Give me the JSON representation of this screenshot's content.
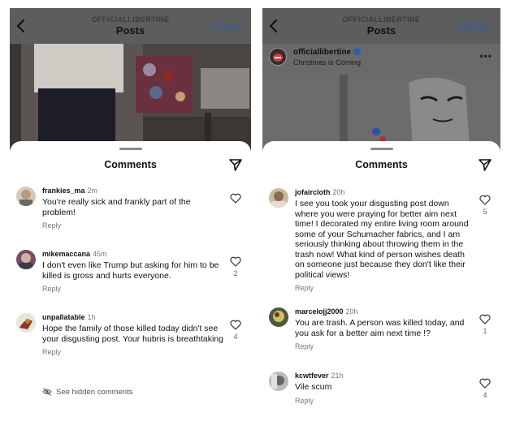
{
  "left": {
    "header": {
      "account": "OFFICIALLIBERTINE",
      "title": "Posts",
      "follow_label": "Follow"
    },
    "sheet_title": "Comments",
    "comments": [
      {
        "user": "frankies_ma",
        "time": "2m",
        "text": "You're really sick and frankly part of the problem!",
        "reply": "Reply",
        "likes": ""
      },
      {
        "user": "mikemaccana",
        "time": "45m",
        "text": "I don't even like Trump but asking for him to be killed is gross and hurts everyone.",
        "reply": "Reply",
        "likes": "2"
      },
      {
        "user": "unpallatable",
        "time": "1h",
        "text": "Hope the family of those killed today didn't see your disgusting post. Your hubris is breathtaking",
        "reply": "Reply",
        "likes": "4"
      }
    ],
    "hidden_comments_label": "See hidden comments"
  },
  "right": {
    "header": {
      "account": "OFFICIALLIBERTINE",
      "title": "Posts",
      "follow_label": "Follow"
    },
    "post": {
      "user": "officiallibertine",
      "subtitle": "Christmas is Coming",
      "more": "•••"
    },
    "sheet_title": "Comments",
    "comments": [
      {
        "user": "jofaircloth",
        "time": "20h",
        "text": "I see you took your disgusting post down where you were praying for better aim next time!  I decorated my entire living room around some of your Schumacher fabrics, and I am seriously thinking about throwing them in the trash now!  What kind of person wishes death on someone just because they don't like their political views!",
        "reply": "Reply",
        "likes": "5"
      },
      {
        "user": "marcelojj2000",
        "time": "20h",
        "text": "You are trash. A person was killed today, and you ask for a better aim next time !?",
        "reply": "Reply",
        "likes": "1"
      },
      {
        "user": "kcwtfever",
        "time": "21h",
        "text": "Vile scum",
        "reply": "Reply",
        "likes": "4"
      }
    ]
  },
  "colors": {
    "follow": "#3b5f8f",
    "verified": "#2f5fa5",
    "muted_text": "#777777"
  }
}
